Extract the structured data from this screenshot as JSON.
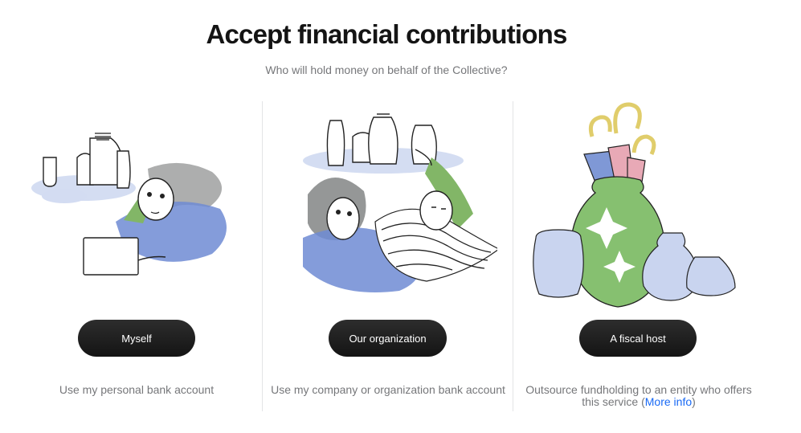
{
  "page": {
    "title": "Accept financial contributions",
    "subtitle": "Who will hold money on behalf of the Collective?"
  },
  "options": [
    {
      "button_label": "Myself",
      "description": "Use my personal bank account",
      "illustration": "person-with-laptop-and-jars"
    },
    {
      "button_label": "Our organization",
      "description": "Use my company or organization bank account",
      "illustration": "two-people-with-jars"
    },
    {
      "button_label": "A fiscal host",
      "description_prefix": "Outsource fundholding to an entity who offers this service (",
      "link_label": "More info",
      "description_suffix": ")",
      "illustration": "vase-with-umbrellas"
    }
  ],
  "colors": {
    "button": "#1a1a1a",
    "link": "#1869f5",
    "muted_text": "#76777a",
    "divider": "#e3e4e6"
  }
}
